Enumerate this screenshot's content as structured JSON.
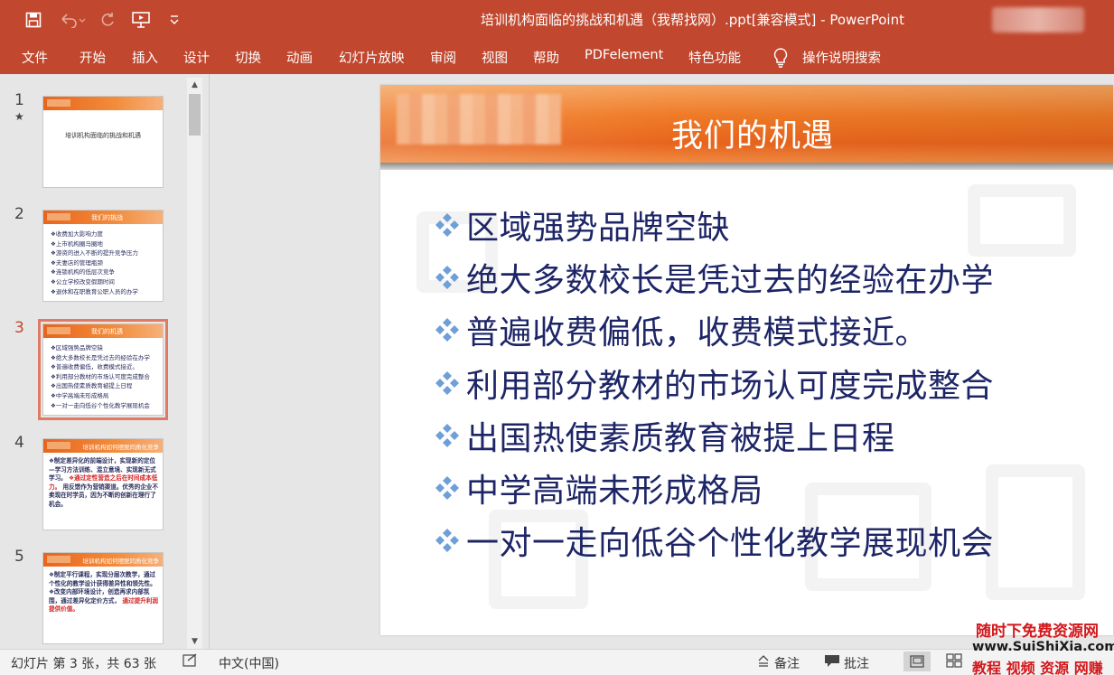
{
  "window": {
    "title": "培训机构面临的挑战和机遇（我帮找网）.ppt[兼容模式]  -  PowerPoint"
  },
  "ribbon": {
    "tabs": [
      "文件",
      "开始",
      "插入",
      "设计",
      "切换",
      "动画",
      "幻灯片放映",
      "审阅",
      "视图",
      "帮助",
      "PDFelement",
      "特色功能"
    ],
    "search_label": "操作说明搜索"
  },
  "thumbnails": [
    {
      "number": "1",
      "star": "★",
      "center_text": "培训机构面临的挑战和机遇"
    },
    {
      "number": "2",
      "title": "我们的挑战",
      "lines": [
        "❖收费加大影响力度",
        "❖上市机构圈马圈地",
        "❖游资的进入不断的提升竞争压力",
        "❖夫妻店的管理瓶颈",
        "❖连锁机构的低层次竞争",
        "❖公立学校改变假期时间",
        "❖退休和在职教育公职人员的办学"
      ]
    },
    {
      "number": "3",
      "title": "我们的机遇",
      "lines": [
        "❖区域强势品牌空缺",
        "❖绝大多数校长是凭过去的经验在办学",
        "❖普遍收费偏低，收费模式接近。",
        "❖利用部分教材的市场认可度完成整合",
        "❖出国热使素质教育被提上日程",
        "❖中学高端未形成格局",
        "❖一对一走向低谷个性化教学展现机会"
      ]
    },
    {
      "number": "4",
      "title": "培训机构如何摆脱同质化竞争",
      "text_a": "❖制定差异化的前端设计，实现新的定位—学习方法训练、混立意境、实现新无式学习。",
      "text_red": "❖通过定性营造之后在时间成本低力。",
      "text_b": "用反馈作为营销渠道。优秀的企业不卖现在时学员，因为不断的创新在理行了机会。"
    },
    {
      "number": "5",
      "title": "培训机构如何摆脱同质化竞争",
      "text_a": "❖制定平行课程，实现分层次教学，通过个性化的教学设计获得差异性和领先性。❖改变内部环境设计，创造再求内部氛围，通过差异化定价方式，",
      "text_red": "通过提升利润提供价值。"
    }
  ],
  "slide": {
    "title": "我们的机遇",
    "bullets": [
      "区域强势品牌空缺",
      "绝大多数校长是凭过去的经验在办学",
      "普遍收费偏低，收费模式接近。",
      "利用部分教材的市场认可度完成整合",
      "出国热使素质教育被提上日程",
      "中学高端未形成格局",
      "一对一走向低谷个性化教学展现机会"
    ]
  },
  "status": {
    "slide_info": "幻灯片 第 3 张，共 63 张",
    "language": "中文(中国)",
    "notes_label": "备注",
    "comments_label": "批注"
  },
  "watermark": {
    "line1": "随时下免费资源网",
    "line2": "www.SuiShiXia.com",
    "line3": "教程 视频 资源 网赚"
  },
  "colors": {
    "accent": "#c1472e",
    "slide_header": "#e8641c",
    "bullet_text": "#1d2566",
    "bullet_diamond": "#6f9fd8"
  }
}
